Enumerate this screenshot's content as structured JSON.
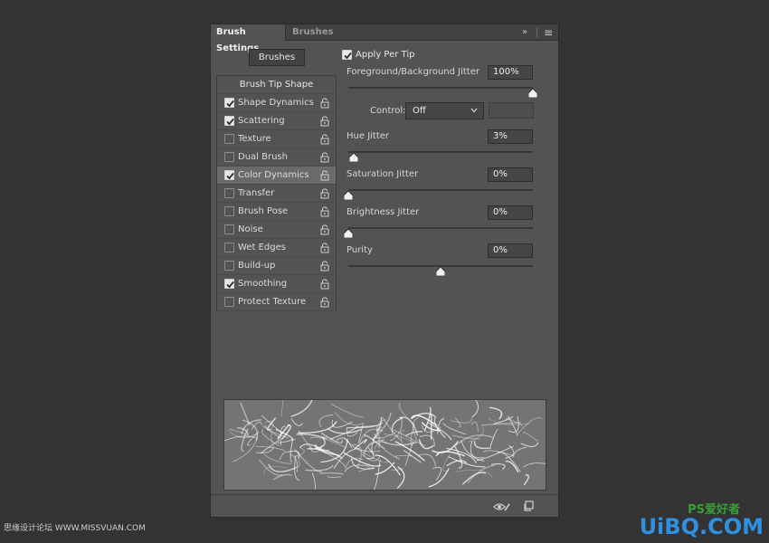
{
  "tabs": {
    "active": "Brush Settings",
    "inactive": "Brushes"
  },
  "toolbar": {
    "expand_icon": "double-chevron-right-icon",
    "menu_icon": "hamburger-menu-icon",
    "expand_glyph": "»",
    "menu_glyph": "≡"
  },
  "brushes_button": "Brushes",
  "left_list": {
    "header": "Brush Tip Shape",
    "items": [
      {
        "label": "Shape Dynamics",
        "checked": true
      },
      {
        "label": "Scattering",
        "checked": true
      },
      {
        "label": "Texture",
        "checked": false
      },
      {
        "label": "Dual Brush",
        "checked": false
      },
      {
        "label": "Color Dynamics",
        "checked": true,
        "selected": true
      },
      {
        "label": "Transfer",
        "checked": false
      },
      {
        "label": "Brush Pose",
        "checked": false
      },
      {
        "label": "Noise",
        "checked": false
      },
      {
        "label": "Wet Edges",
        "checked": false
      },
      {
        "label": "Build-up",
        "checked": false
      },
      {
        "label": "Smoothing",
        "checked": true
      },
      {
        "label": "Protect Texture",
        "checked": false
      }
    ]
  },
  "right": {
    "apply_per_tip": {
      "label": "Apply Per Tip",
      "checked": true
    },
    "fg_bg_jitter": {
      "label": "Foreground/Background Jitter",
      "value": "100%",
      "slider": 1.0
    },
    "control": {
      "label": "Control:",
      "value": "Off"
    },
    "hue_jitter": {
      "label": "Hue Jitter",
      "value": "3%",
      "slider": 0.03
    },
    "saturation_jitter": {
      "label": "Saturation Jitter",
      "value": "0%",
      "slider": 0.0
    },
    "brightness_jitter": {
      "label": "Brightness Jitter",
      "value": "0%",
      "slider": 0.0
    },
    "purity": {
      "label": "Purity",
      "value": "0%",
      "slider": 0.5
    }
  },
  "bottom_icons": [
    "eye-brush-icon",
    "new-preset-icon"
  ],
  "watermark": {
    "left": "思缘设计论坛 WWW.MISSVUAN.COM",
    "right_tag": "PS爱好者",
    "right_logo": "UiBQ.COM"
  },
  "colors": {
    "background": "#333333",
    "panel": "#535353",
    "selected_row": "#6a6a6a",
    "logo_blue": "#2f8fe0",
    "tag_green": "#38a038"
  }
}
